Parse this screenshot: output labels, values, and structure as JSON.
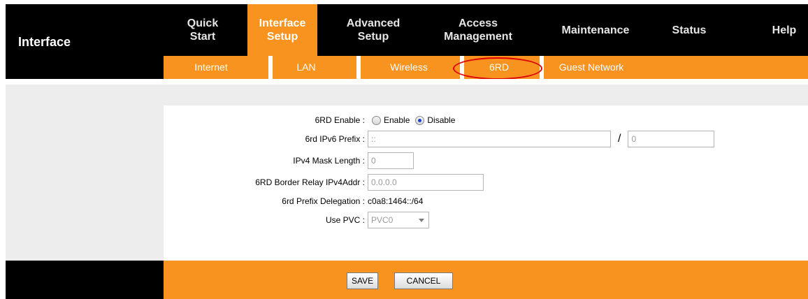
{
  "sidebar": {
    "title": "Interface"
  },
  "topnav": {
    "tabs": [
      {
        "label": "Quick\nStart",
        "active": false
      },
      {
        "label": "Interface\nSetup",
        "active": true
      },
      {
        "label": "Advanced\nSetup",
        "active": false
      },
      {
        "label": "Access\nManagement",
        "active": false
      },
      {
        "label": "Maintenance",
        "active": false
      },
      {
        "label": "Status",
        "active": false
      },
      {
        "label": "Help",
        "active": false
      }
    ]
  },
  "subnav": {
    "items": [
      {
        "label": "Internet"
      },
      {
        "label": "LAN"
      },
      {
        "label": "Wireless"
      },
      {
        "label": "6RD",
        "selected": true
      },
      {
        "label": "Guest Network"
      }
    ]
  },
  "form": {
    "enable": {
      "label": "6RD Enable",
      "option_enable": "Enable",
      "option_disable": "Disable",
      "selected": "Disable"
    },
    "prefix": {
      "label": "6rd IPv6 Prefix",
      "value": "::",
      "separator": "/",
      "length": "0"
    },
    "mask": {
      "label": "IPv4 Mask Length",
      "value": "0"
    },
    "relay": {
      "label": "6RD Border Relay IPv4Addr",
      "value": "0.0.0.0"
    },
    "delegation": {
      "label": "6rd Prefix Delegation",
      "value": "c0a8:1464::/64"
    },
    "pvc": {
      "label": "Use PVC",
      "value": "PVC0"
    }
  },
  "colon": ":",
  "footer": {
    "save_label": "SAVE",
    "cancel_label": "CANCEL"
  },
  "colors": {
    "accent": "#f7931e",
    "dark": "#000000",
    "highlight": "#e00000"
  }
}
